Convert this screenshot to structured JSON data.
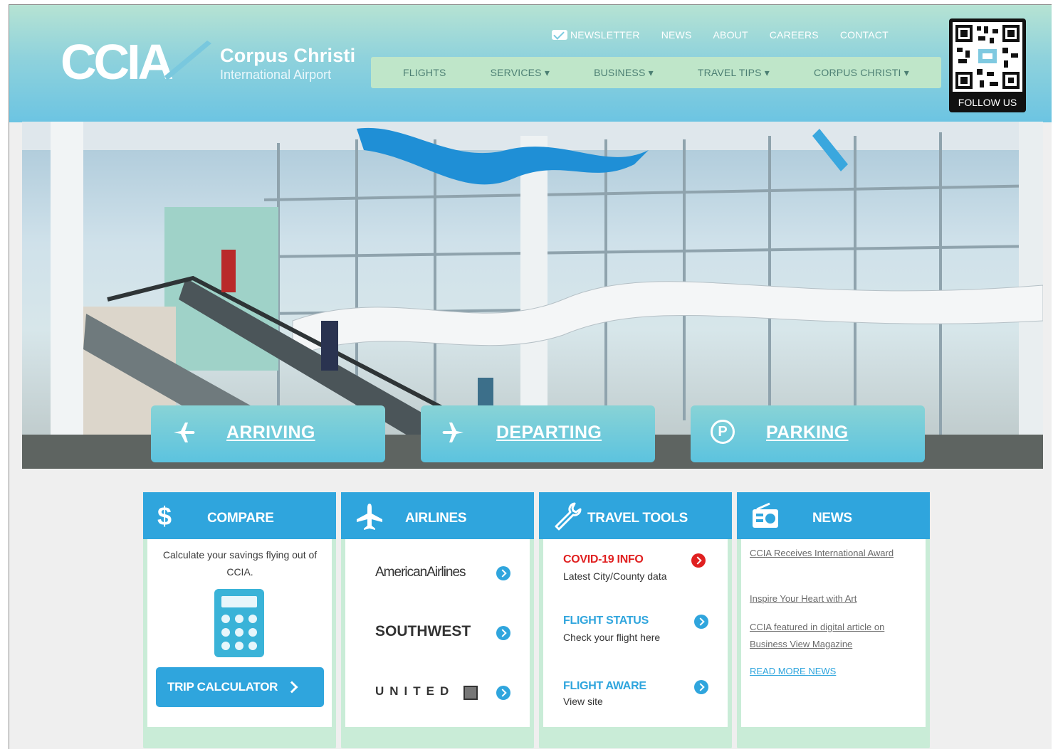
{
  "header": {
    "logo_mark": "CCIA",
    "logo_name": "Corpus Christi",
    "logo_sub": "International Airport",
    "top_nav": [
      "NEWSLETTER",
      "NEWS",
      "ABOUT",
      "CAREERS",
      "CONTACT"
    ],
    "main_nav": [
      "FLIGHTS",
      "SERVICES ▾",
      "BUSINESS ▾",
      "TRAVEL TIPS ▾",
      "CORPUS CHRISTI ▾"
    ],
    "qr_label": "FOLLOW US"
  },
  "hero": {
    "buttons": [
      {
        "label": "ARRIVING",
        "icon": "plane-arriving-icon"
      },
      {
        "label": "DEPARTING",
        "icon": "plane-departing-icon"
      },
      {
        "label": "PARKING",
        "icon": "parking-icon",
        "icon_text": "P"
      }
    ]
  },
  "cards": {
    "compare": {
      "title": "COMPARE",
      "icon_text": "$",
      "text": "Calculate your savings flying out of CCIA.",
      "button": "TRIP CALCULATOR"
    },
    "airlines": {
      "title": "AIRLINES",
      "items": [
        "AmericanAirlines",
        "SOUTHWEST",
        "UNITED"
      ]
    },
    "travel_tools": {
      "title": "TRAVEL TOOLS",
      "items": [
        {
          "title": "COVID-19 INFO",
          "sub": "Latest City/County data",
          "color": "#e02020"
        },
        {
          "title": "FLIGHT STATUS",
          "sub": "Check your flight here",
          "color": "#2fa5dd"
        },
        {
          "title": "FLIGHT AWARE",
          "sub": "View site",
          "color": "#2fa5dd"
        }
      ]
    },
    "news": {
      "title": "NEWS",
      "items": [
        "CCIA Receives International Award",
        "Inspire Your Heart with Art",
        "CCIA featured in digital article on Business View Magazine"
      ],
      "more": "READ MORE NEWS"
    }
  },
  "colors": {
    "accent": "#2fa5dd",
    "nav_bg": "#bfe6c9",
    "card_frame": "#c9ecd7",
    "alert": "#e02020"
  }
}
